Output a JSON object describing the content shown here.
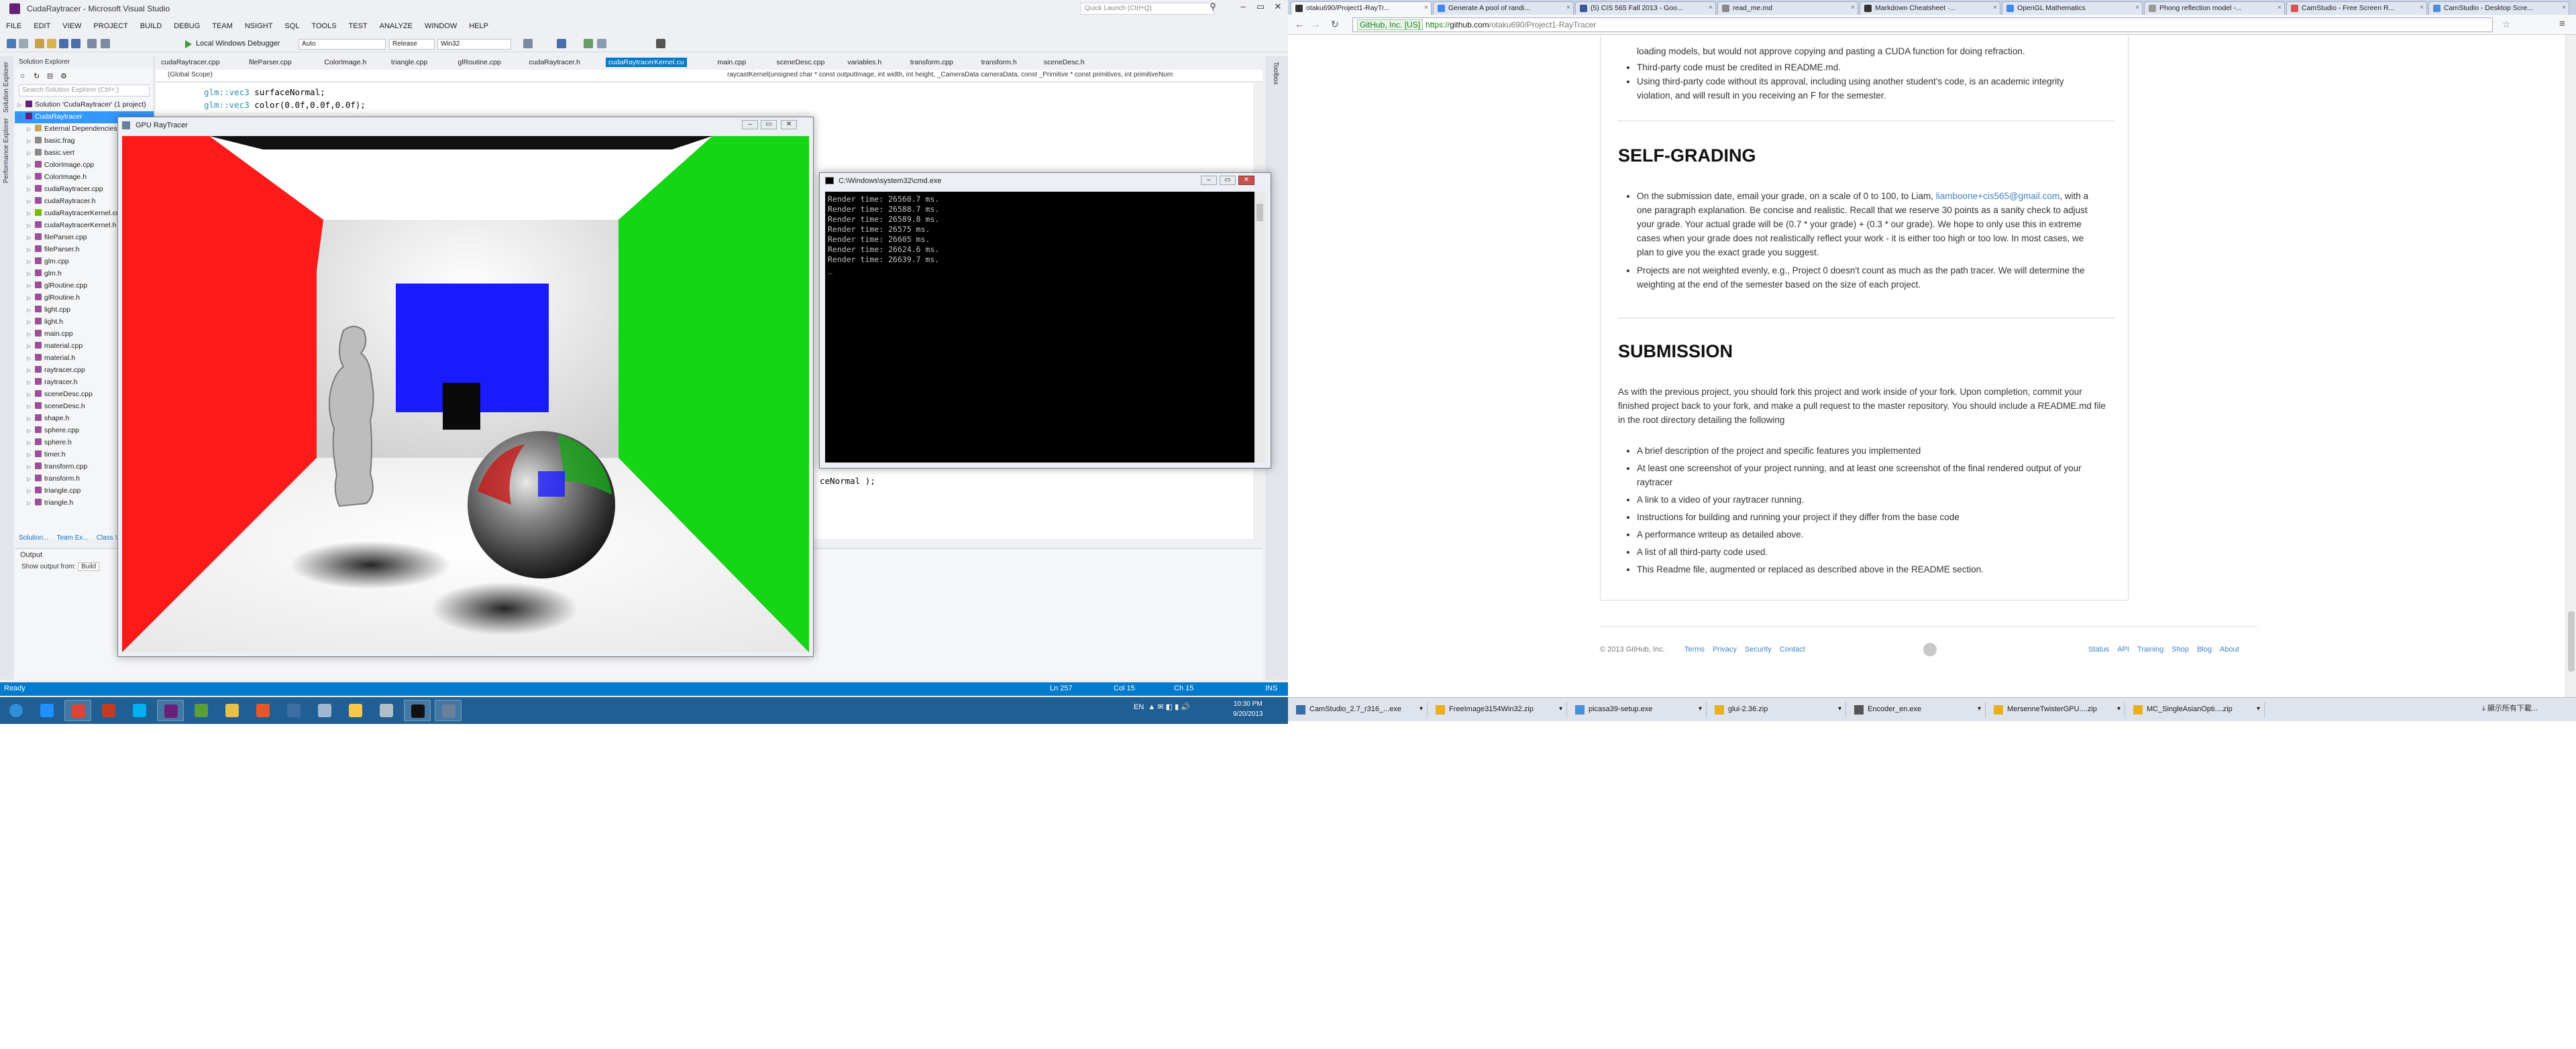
{
  "vs": {
    "title": "CudaRaytracer - Microsoft Visual Studio",
    "quick_launch": "Quick Launch (Ctrl+Q)",
    "menu": [
      "FILE",
      "EDIT",
      "VIEW",
      "PROJECT",
      "BUILD",
      "DEBUG",
      "TEAM",
      "NSIGHT",
      "SQL",
      "TOOLS",
      "TEST",
      "ANALYZE",
      "WINDOW",
      "HELP"
    ],
    "toolbar": {
      "debugger": "Local Windows Debugger",
      "auto": "Auto",
      "config": "Release",
      "platform": "Win32"
    },
    "left_tabs": [
      "Solution Explorer",
      "Performance Explorer"
    ],
    "right_tab": "Toolbox",
    "solution_explorer": {
      "title": "Solution Explorer",
      "search": "Search Solution Explorer (Ctrl+;)",
      "items": [
        {
          "label": "Solution 'CudaRaytracer' (1 project)",
          "level": 0,
          "color": "#68217a"
        },
        {
          "label": "CudaRaytracer",
          "level": 0,
          "color": "#68217a",
          "selected": true
        },
        {
          "label": "External Dependencies",
          "level": 1,
          "color": "#c5a55a"
        },
        {
          "label": "basic.frag",
          "level": 1,
          "color": "#8a8a8a"
        },
        {
          "label": "basic.vert",
          "level": 1,
          "color": "#8a8a8a"
        },
        {
          "label": "ColorImage.cpp",
          "level": 1,
          "color": "#9b4f96"
        },
        {
          "label": "ColorImage.h",
          "level": 1,
          "color": "#9b4f96"
        },
        {
          "label": "cudaRaytracer.cpp",
          "level": 1,
          "color": "#9b4f96"
        },
        {
          "label": "cudaRaytracer.h",
          "level": 1,
          "color": "#9b4f96"
        },
        {
          "label": "cudaRaytracerKernel.cu",
          "level": 1,
          "color": "#76b900"
        },
        {
          "label": "cudaRaytracerKernel.h",
          "level": 1,
          "color": "#9b4f96"
        },
        {
          "label": "fileParser.cpp",
          "level": 1,
          "color": "#9b4f96"
        },
        {
          "label": "fileParser.h",
          "level": 1,
          "color": "#9b4f96"
        },
        {
          "label": "glm.cpp",
          "level": 1,
          "color": "#9b4f96"
        },
        {
          "label": "glm.h",
          "level": 1,
          "color": "#9b4f96"
        },
        {
          "label": "glRoutine.cpp",
          "level": 1,
          "color": "#9b4f96"
        },
        {
          "label": "glRoutine.h",
          "level": 1,
          "color": "#9b4f96"
        },
        {
          "label": "light.cpp",
          "level": 1,
          "color": "#9b4f96"
        },
        {
          "label": "light.h",
          "level": 1,
          "color": "#9b4f96"
        },
        {
          "label": "main.cpp",
          "level": 1,
          "color": "#9b4f96"
        },
        {
          "label": "material.cpp",
          "level": 1,
          "color": "#9b4f96"
        },
        {
          "label": "material.h",
          "level": 1,
          "color": "#9b4f96"
        },
        {
          "label": "raytracer.cpp",
          "level": 1,
          "color": "#9b4f96"
        },
        {
          "label": "raytracer.h",
          "level": 1,
          "color": "#9b4f96"
        },
        {
          "label": "sceneDesc.cpp",
          "level": 1,
          "color": "#9b4f96"
        },
        {
          "label": "sceneDesc.h",
          "level": 1,
          "color": "#9b4f96"
        },
        {
          "label": "shape.h",
          "level": 1,
          "color": "#9b4f96"
        },
        {
          "label": "sphere.cpp",
          "level": 1,
          "color": "#9b4f96"
        },
        {
          "label": "sphere.h",
          "level": 1,
          "color": "#9b4f96"
        },
        {
          "label": "timer.h",
          "level": 1,
          "color": "#9b4f96"
        },
        {
          "label": "transform.cpp",
          "level": 1,
          "color": "#9b4f96"
        },
        {
          "label": "transform.h",
          "level": 1,
          "color": "#9b4f96"
        },
        {
          "label": "triangle.cpp",
          "level": 1,
          "color": "#9b4f96"
        },
        {
          "label": "triangle.h",
          "level": 1,
          "color": "#9b4f96"
        }
      ],
      "bottom_tabs": [
        "Solution...",
        "Team Ex...",
        "Class Vi..."
      ]
    },
    "doc_tabs": [
      "cudaRaytracer.cpp",
      "fileParser.cpp",
      "ColorImage.h",
      "triangle.cpp",
      "glRoutine.cpp",
      "cudaRaytracer.h",
      "cudaRaytracerKernel.cu",
      "main.cpp",
      "sceneDesc.cpp",
      "variables.h",
      "transform.cpp",
      "transform.h",
      "sceneDesc.h"
    ],
    "active_tab": "cudaRaytracerKernel.cu",
    "nav_scope": "(Global Scope)",
    "nav_func": "raycastKernel(unsigned char * const outputImage, int width, int height, _CameraData cameraData, const _Primitive * const primitives, int primitiveNum",
    "code_lines": [
      {
        "type": "glm::vec3",
        "rest": " surfaceNormal;"
      },
      {
        "type": "glm::vec3",
        "rest": " color(0.0f,0.0f,0.0f);"
      }
    ],
    "code_tail": "ceNormal );",
    "output": {
      "title": "Output",
      "show_from": "Show output from:",
      "source": "Build"
    },
    "status": {
      "ready": "Ready",
      "ln": "Ln 257",
      "col": "Col 15",
      "ch": "Ch 15",
      "ins": "INS"
    }
  },
  "gpu_window": {
    "title": "GPU RayTracer"
  },
  "cmd_window": {
    "title": "C:\\Windows\\system32\\cmd.exe",
    "lines": [
      "Render time: 26560.7 ms.",
      "Render time: 26588.7 ms.",
      "Render time: 26589.8 ms.",
      "Render time: 26575 ms.",
      "Render time: 26605 ms.",
      "Render time: 26624.6 ms.",
      "Render time: 26639.7 ms.",
      "_"
    ]
  },
  "browser": {
    "tabs": [
      {
        "label": "otaku690/Project1-RayTr...",
        "color": "#333333",
        "active": true
      },
      {
        "label": "Generate A pool of randi...",
        "color": "#4285f4"
      },
      {
        "label": "(5) CIS 565 Fall 2013 - Goo...",
        "color": "#3b5998"
      },
      {
        "label": "read_me.md",
        "color": "#888888"
      },
      {
        "label": "Markdown Cheatsheet ·...",
        "color": "#333333"
      },
      {
        "label": "OpenGL Mathematics",
        "color": "#4285f4"
      },
      {
        "label": "Phong reflection model -...",
        "color": "#999999"
      },
      {
        "label": "CamStudio - Free Screen R...",
        "color": "#d9534f"
      },
      {
        "label": "CamStudio - Desktop Scre...",
        "color": "#4a90d9"
      }
    ],
    "url_ev": "GitHub, Inc. [US]",
    "url_scheme": "https://",
    "url_domain": "github.com",
    "url_path": "/otaku690/Project1-RayTracer",
    "readme": {
      "top_frag": "loading models, but would not approve copying and pasting a CUDA function for doing refraction.",
      "top_items": [
        "Third-party code must be credited in README.md.",
        "Using third-party code without its approval, including using another student's code, is an academic integrity violation, and will result in you receiving an F for the semester."
      ],
      "h_self": "SELF-GRADING",
      "self_items": [
        {
          "pre": "On the submission date, email your grade, on a scale of 0 to 100, to Liam, ",
          "link": "liamboone+cis565@gmail.com",
          "post": ", with a one paragraph explanation. Be concise and realistic. Recall that we reserve 30 points as a sanity check to adjust your grade. Your actual grade will be (0.7 * your grade) + (0.3 * our grade). We hope to only use this in extreme cases when your grade does not realistically reflect your work - it is either too high or too low. In most cases, we plan to give you the exact grade you suggest."
        },
        {
          "pre": "Projects are not weighted evenly, e.g., Project 0 doesn't count as much as the path tracer. We will determine the weighting at the end of the semester based on the size of each project.",
          "link": "",
          "post": ""
        }
      ],
      "h_sub": "SUBMISSION",
      "sub_para": "As with the previous project, you should fork this project and work inside of your fork. Upon completion, commit your finished project back to your fork, and make a pull request to the master repository. You should include a README.md file in the root directory detailing the following",
      "sub_items": [
        "A brief description of the project and specific features you implemented",
        "At least one screenshot of your project running, and at least one screenshot of the final rendered output of your raytracer",
        "A link to a video of your raytracer running.",
        "Instructions for building and running your project if they differ from the base code",
        "A performance writeup as detailed above.",
        "A list of all third-party code used.",
        "This Readme file, augmented or replaced as described above in the README section."
      ]
    },
    "footer": {
      "copyright": "© 2013 GitHub, Inc.",
      "left_links": [
        "Terms",
        "Privacy",
        "Security",
        "Contact"
      ],
      "right_links": [
        "Status",
        "API",
        "Training",
        "Shop",
        "Blog",
        "About"
      ]
    },
    "downloads": [
      {
        "label": "CamStudio_2.7_r316_...exe",
        "color": "#3a6ea5"
      },
      {
        "label": "FreeImage3154Win32.zip",
        "color": "#e8b020"
      },
      {
        "label": "picasa39-setup.exe",
        "color": "#4a90d9"
      },
      {
        "label": "glui-2.36.zip",
        "color": "#e8b020"
      },
      {
        "label": "Encoder_en.exe",
        "color": "#555555"
      },
      {
        "label": "MersenneTwisterGPU....zip",
        "color": "#e8b020"
      },
      {
        "label": "MC_SingleAsianOpti....zip",
        "color": "#e8b020"
      }
    ],
    "show_all": "顯示所有下載..."
  },
  "taskbar": {
    "apps": [
      {
        "name": "start",
        "color": "#2f8fd8"
      },
      {
        "name": "ie",
        "color": "#1e90ff"
      },
      {
        "name": "chrome",
        "color": "#db4437"
      },
      {
        "name": "calendar",
        "color": "#c23b22"
      },
      {
        "name": "skype",
        "color": "#00aff0"
      },
      {
        "name": "visual-studio",
        "color": "#68217a"
      },
      {
        "name": "notepad",
        "color": "#5a9e3a"
      },
      {
        "name": "explorer",
        "color": "#e8c04a"
      },
      {
        "name": "git",
        "color": "#e4572e"
      },
      {
        "name": "network",
        "color": "#3a6ea5"
      },
      {
        "name": "documents",
        "color": "#9fb7d0"
      },
      {
        "name": "keys",
        "color": "#f2c94c"
      },
      {
        "name": "remote",
        "color": "#b0bec5"
      },
      {
        "name": "cmd",
        "color": "#111111"
      },
      {
        "name": "viewer",
        "color": "#6a7f9a"
      }
    ],
    "lang": "EN",
    "time": "10:30 PM",
    "date": "9/20/2013"
  },
  "colors": {
    "vs_accent": "#007acc",
    "vs_bg": "#eef0f4",
    "taskbar": "#1f5f93",
    "link": "#4183c4"
  }
}
